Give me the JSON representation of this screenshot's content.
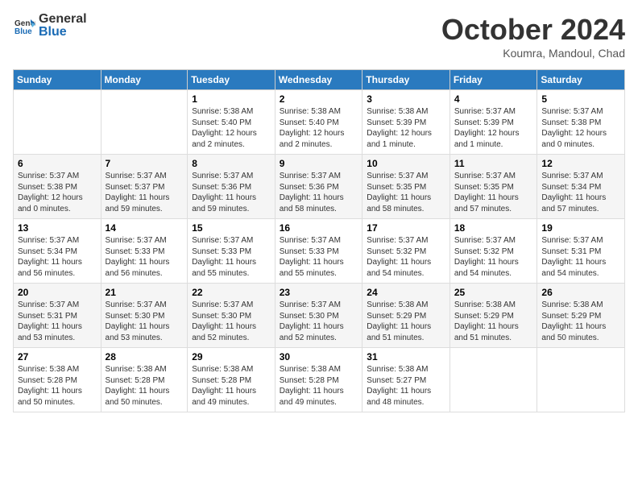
{
  "logo": {
    "line1": "General",
    "line2": "Blue"
  },
  "header": {
    "month": "October 2024",
    "location": "Koumra, Mandoul, Chad"
  },
  "days_of_week": [
    "Sunday",
    "Monday",
    "Tuesday",
    "Wednesday",
    "Thursday",
    "Friday",
    "Saturday"
  ],
  "weeks": [
    [
      {
        "num": "",
        "info": ""
      },
      {
        "num": "",
        "info": ""
      },
      {
        "num": "1",
        "info": "Sunrise: 5:38 AM\nSunset: 5:40 PM\nDaylight: 12 hours\nand 2 minutes."
      },
      {
        "num": "2",
        "info": "Sunrise: 5:38 AM\nSunset: 5:40 PM\nDaylight: 12 hours\nand 2 minutes."
      },
      {
        "num": "3",
        "info": "Sunrise: 5:38 AM\nSunset: 5:39 PM\nDaylight: 12 hours\nand 1 minute."
      },
      {
        "num": "4",
        "info": "Sunrise: 5:37 AM\nSunset: 5:39 PM\nDaylight: 12 hours\nand 1 minute."
      },
      {
        "num": "5",
        "info": "Sunrise: 5:37 AM\nSunset: 5:38 PM\nDaylight: 12 hours\nand 0 minutes."
      }
    ],
    [
      {
        "num": "6",
        "info": "Sunrise: 5:37 AM\nSunset: 5:38 PM\nDaylight: 12 hours\nand 0 minutes."
      },
      {
        "num": "7",
        "info": "Sunrise: 5:37 AM\nSunset: 5:37 PM\nDaylight: 11 hours\nand 59 minutes."
      },
      {
        "num": "8",
        "info": "Sunrise: 5:37 AM\nSunset: 5:36 PM\nDaylight: 11 hours\nand 59 minutes."
      },
      {
        "num": "9",
        "info": "Sunrise: 5:37 AM\nSunset: 5:36 PM\nDaylight: 11 hours\nand 58 minutes."
      },
      {
        "num": "10",
        "info": "Sunrise: 5:37 AM\nSunset: 5:35 PM\nDaylight: 11 hours\nand 58 minutes."
      },
      {
        "num": "11",
        "info": "Sunrise: 5:37 AM\nSunset: 5:35 PM\nDaylight: 11 hours\nand 57 minutes."
      },
      {
        "num": "12",
        "info": "Sunrise: 5:37 AM\nSunset: 5:34 PM\nDaylight: 11 hours\nand 57 minutes."
      }
    ],
    [
      {
        "num": "13",
        "info": "Sunrise: 5:37 AM\nSunset: 5:34 PM\nDaylight: 11 hours\nand 56 minutes."
      },
      {
        "num": "14",
        "info": "Sunrise: 5:37 AM\nSunset: 5:33 PM\nDaylight: 11 hours\nand 56 minutes."
      },
      {
        "num": "15",
        "info": "Sunrise: 5:37 AM\nSunset: 5:33 PM\nDaylight: 11 hours\nand 55 minutes."
      },
      {
        "num": "16",
        "info": "Sunrise: 5:37 AM\nSunset: 5:33 PM\nDaylight: 11 hours\nand 55 minutes."
      },
      {
        "num": "17",
        "info": "Sunrise: 5:37 AM\nSunset: 5:32 PM\nDaylight: 11 hours\nand 54 minutes."
      },
      {
        "num": "18",
        "info": "Sunrise: 5:37 AM\nSunset: 5:32 PM\nDaylight: 11 hours\nand 54 minutes."
      },
      {
        "num": "19",
        "info": "Sunrise: 5:37 AM\nSunset: 5:31 PM\nDaylight: 11 hours\nand 54 minutes."
      }
    ],
    [
      {
        "num": "20",
        "info": "Sunrise: 5:37 AM\nSunset: 5:31 PM\nDaylight: 11 hours\nand 53 minutes."
      },
      {
        "num": "21",
        "info": "Sunrise: 5:37 AM\nSunset: 5:30 PM\nDaylight: 11 hours\nand 53 minutes."
      },
      {
        "num": "22",
        "info": "Sunrise: 5:37 AM\nSunset: 5:30 PM\nDaylight: 11 hours\nand 52 minutes."
      },
      {
        "num": "23",
        "info": "Sunrise: 5:37 AM\nSunset: 5:30 PM\nDaylight: 11 hours\nand 52 minutes."
      },
      {
        "num": "24",
        "info": "Sunrise: 5:38 AM\nSunset: 5:29 PM\nDaylight: 11 hours\nand 51 minutes."
      },
      {
        "num": "25",
        "info": "Sunrise: 5:38 AM\nSunset: 5:29 PM\nDaylight: 11 hours\nand 51 minutes."
      },
      {
        "num": "26",
        "info": "Sunrise: 5:38 AM\nSunset: 5:29 PM\nDaylight: 11 hours\nand 50 minutes."
      }
    ],
    [
      {
        "num": "27",
        "info": "Sunrise: 5:38 AM\nSunset: 5:28 PM\nDaylight: 11 hours\nand 50 minutes."
      },
      {
        "num": "28",
        "info": "Sunrise: 5:38 AM\nSunset: 5:28 PM\nDaylight: 11 hours\nand 50 minutes."
      },
      {
        "num": "29",
        "info": "Sunrise: 5:38 AM\nSunset: 5:28 PM\nDaylight: 11 hours\nand 49 minutes."
      },
      {
        "num": "30",
        "info": "Sunrise: 5:38 AM\nSunset: 5:28 PM\nDaylight: 11 hours\nand 49 minutes."
      },
      {
        "num": "31",
        "info": "Sunrise: 5:38 AM\nSunset: 5:27 PM\nDaylight: 11 hours\nand 48 minutes."
      },
      {
        "num": "",
        "info": ""
      },
      {
        "num": "",
        "info": ""
      }
    ]
  ]
}
